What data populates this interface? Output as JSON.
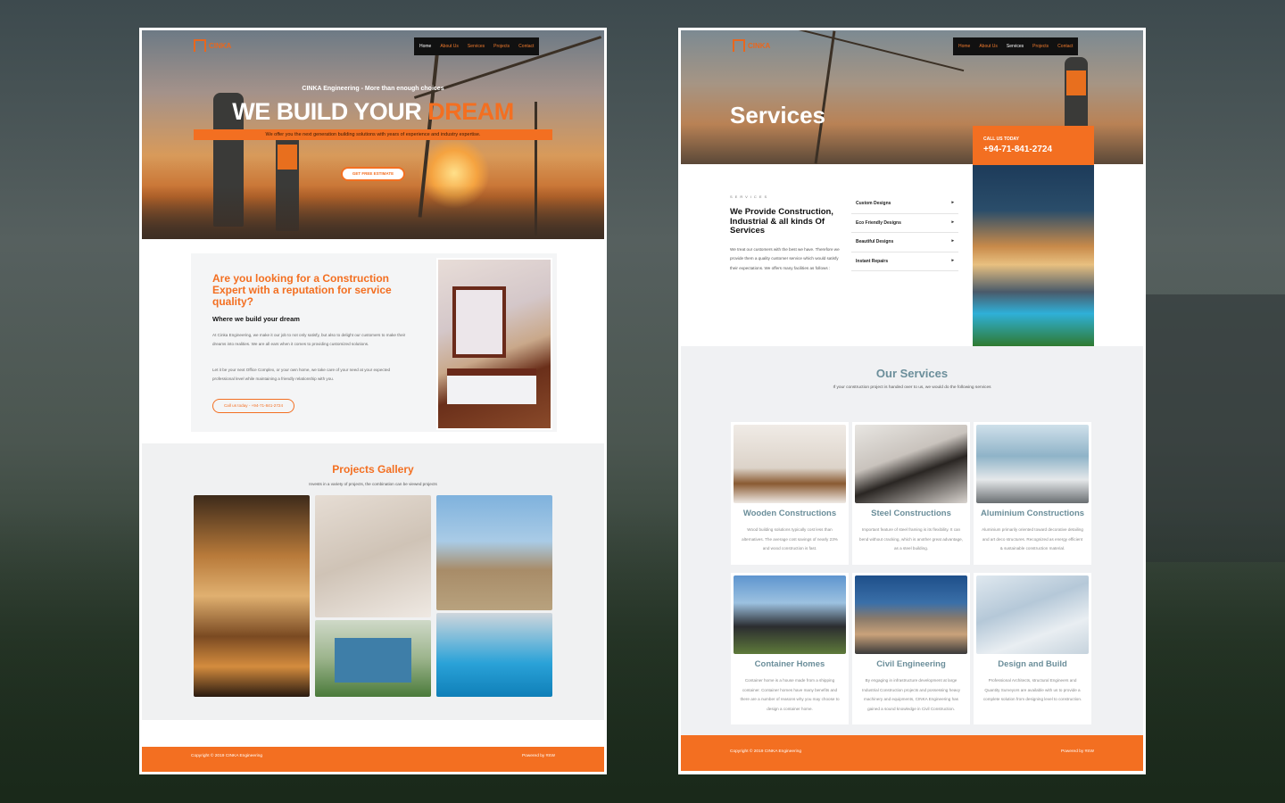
{
  "left": {
    "logo": "CINKA",
    "nav": [
      "Home",
      "About Us",
      "Services",
      "Projects",
      "Contact"
    ],
    "hero": {
      "tagline": "CINKA Engineering - More than enough choices",
      "title_main": "WE BUILD YOUR ",
      "title_accent": "DREAM",
      "strip": "We offer you the next generation building solutions with years of experience and industry expertise.",
      "cta": "GET FREE ESTIMATE"
    },
    "about": {
      "heading": "Are you looking for a Construction Expert with a reputation for service quality?",
      "subheading": "Where we build your dream",
      "p1": "At Cinka Engineering, we make it our job to not only satisfy, but also to delight our customers to make their dreams into realities. We are all ears when it comes to providing customized solutions.",
      "p2": "Let it be your next Office Complex, or your own home, we take care of your need at your expected professional level while maintaining a friendly relationship with you.",
      "call": "Call us today - +94-71-841-2724"
    },
    "gallery": {
      "title": "Projects Gallery",
      "subtitle": "Invests in a variety of projects, the combination can be viewed projects"
    },
    "footer": {
      "copyright": "Copyright © 2019 CINKA Engineering",
      "powered": "Powered by #SW"
    }
  },
  "right": {
    "logo": "CINKA",
    "nav": [
      "Home",
      "About Us",
      "Services",
      "Projects",
      "Contact"
    ],
    "hero_title": "Services",
    "call_box": {
      "label": "CALL US TODAY",
      "phone": "+94-71-841-2724"
    },
    "intro": {
      "kicker": "SERVICES",
      "heading": "We Provide Construction, Industrial & all kinds Of Services",
      "text": "We treat our customers with the best we have. Therefore we provide them a quality customer service which would satisfy their expectations. We offers many facilities as follows :"
    },
    "service_list": [
      "Custom Designs",
      "Eco Friendly Designs",
      "Beautiful Designs",
      "Instant Repairs"
    ],
    "our_services": {
      "title": "Our Services",
      "subtitle": "If your construction project is handed over to us, we would do the following services",
      "cards": [
        {
          "title": "Wooden Constructions",
          "text": "Wood building solutions typically cost less than alternatives. The average cost savings of nearly 23% and wood construction is fast."
        },
        {
          "title": "Steel Constructions",
          "text": "Important feature of steel framing is its flexibility. It can bend without cracking, which is another great advantage, as a steel building."
        },
        {
          "title": "Aluminium Constructions",
          "text": "Aluminium primarily oriented toward decorative detailing and art deco structures. Recognized as energy efficient & sustainable construction material."
        },
        {
          "title": "Container Homes",
          "text": "Container home is a house made from a shipping container. Container homes have many benefits and there are a number of reasons why you may choose to design a container home."
        },
        {
          "title": "Civil Engineering",
          "text": "By engaging in infrastructure development at large Industrial Construction projects and possessing heavy machinery and equipments, CINKA Engineering has gained a sound knowledge in Civil Construction."
        },
        {
          "title": "Design and Build",
          "text": "Professional Architects, structural Engineers and Quantity Surveyors are available with us to provide a complete solution from designing level to construction."
        }
      ]
    },
    "footer": {
      "copyright": "Copyright © 2019 CINKA Engineering",
      "powered": "Powered by #SW"
    }
  },
  "colors": {
    "accent": "#f36f21",
    "teal": "#6b8e9a",
    "dark": "#111111"
  }
}
